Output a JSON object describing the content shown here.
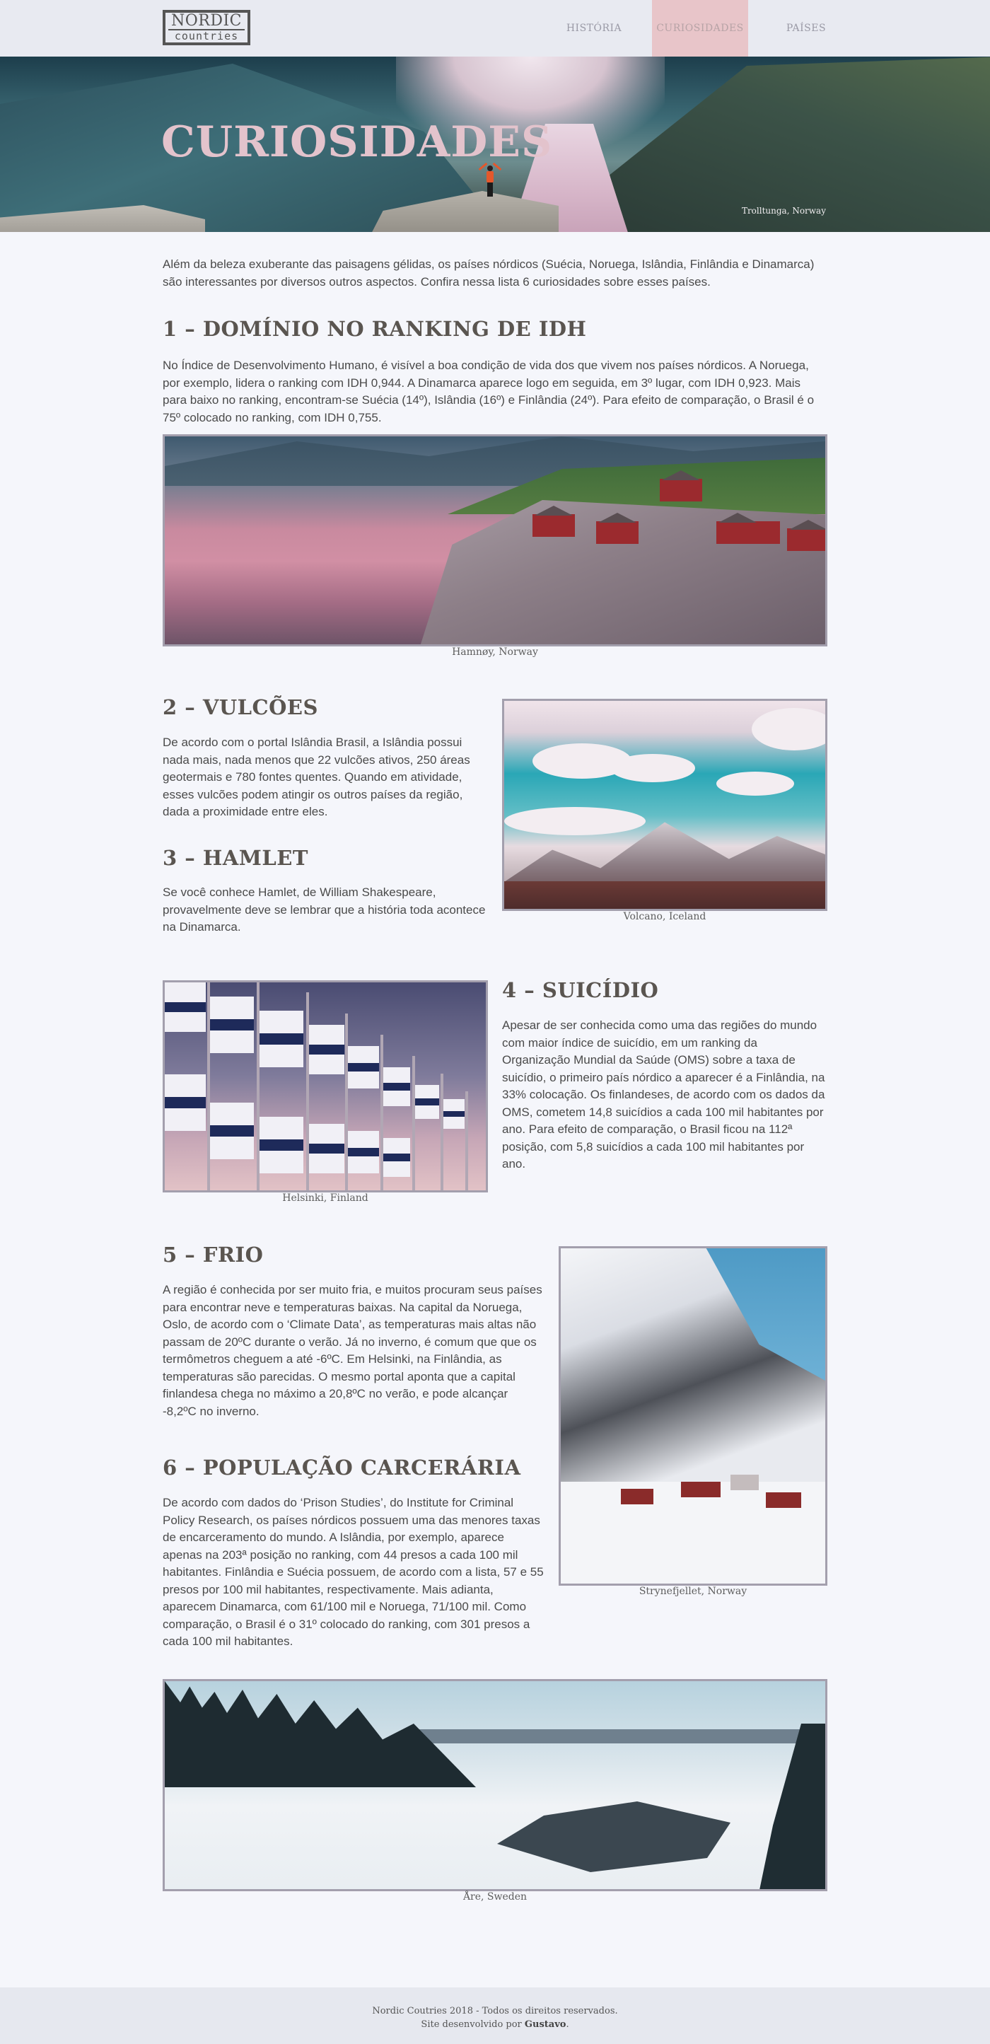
{
  "header": {
    "logo": {
      "line1": "NORDIC",
      "line2": "countries"
    },
    "nav": [
      {
        "label": "HISTÓRIA",
        "active": false
      },
      {
        "label": "CURIOSIDADES",
        "active": true
      },
      {
        "label": "PAÍSES",
        "active": false
      }
    ]
  },
  "hero": {
    "title": "CURIOSIDADES",
    "caption": "Trolltunga, Norway"
  },
  "intro": "Além da beleza exuberante das paisagens gélidas, os países nórdicos (Suécia, Noruega, Islândia, Finlândia e Dinamarca) são interessantes por diversos outros aspectos. Confira nessa lista 6 curiosidades sobre esses países.",
  "sections": [
    {
      "title": "1 – DOMÍNIO NO RANKING DE IDH",
      "text": "No Índice de Desenvolvimento Humano, é visível a boa condição de vida dos que vivem nos países nórdicos. A Noruega, por exemplo, lidera o ranking com IDH 0,944. A Dinamarca aparece logo em seguida, em 3º lugar, com IDH 0,923. Mais para baixo no ranking, encontram-se Suécia (14º), Islândia (16º) e Finlândia (24º). Para efeito de comparação, o Brasil é o 75º colocado no ranking, com IDH 0,755.",
      "caption": "Hamnøy, Norway"
    },
    {
      "title": "2 – VULCÕES",
      "text": "De acordo com o portal Islândia Brasil, a Islândia possui nada mais, nada menos que 22 vulcões ativos, 250 áreas geotermais e 780 fontes quentes. Quando em atividade, esses vulcões podem atingir os outros países da região, dada a proximidade entre eles.",
      "caption": "Volcano, Iceland"
    },
    {
      "title": "3 – HAMLET",
      "text": "Se você conhece Hamlet, de William Shakespeare, provavelmente deve se lembrar que a história toda acontece na Dinamarca."
    },
    {
      "title": "4 – SUICÍDIO",
      "text": "Apesar de ser conhecida como uma das regiões do mundo com maior índice de suicídio, em um ranking da Organização Mundial da Saúde (OMS) sobre a taxa de suicídio, o primeiro país nórdico a aparecer é a Finlândia, na 33% colocação. Os finlandeses, de acordo com os dados da OMS, cometem 14,8 suicídios a cada 100 mil habitantes por ano. Para efeito de comparação, o Brasil ficou na 112ª posição, com 5,8 suicídios a cada 100 mil habitantes por ano.",
      "caption": "Helsinki, Finland"
    },
    {
      "title": "5 – FRIO",
      "text": "A região é conhecida por ser muito fria, e muitos procuram seus países para encontrar neve e temperaturas baixas. Na capital da Noruega, Oslo, de acordo com o ‘Climate Data’, as temperaturas mais altas não passam de 20ºC durante o verão. Já no inverno, é comum que que os termômetros cheguem a até -6ºC. Em Helsinki, na Finlândia, as temperaturas são parecidas. O mesmo portal aponta que a capital finlandesa chega no máximo a 20,8ºC no verão, e pode alcançar -8,2ºC no inverno.",
      "caption": "Strynefjellet, Norway"
    },
    {
      "title": "6 – POPULAÇÃO CARCERÁRIA",
      "text": "De acordo com dados do ‘Prison Studies’, do Institute for Criminal Policy Research, os países nórdicos possuem uma das menores taxas de encarceramento do mundo. A Islândia, por exemplo, aparece apenas na 203ª posição no ranking, com 44 presos a cada 100 mil habitantes. Finlândia e Suécia possuem, de acordo com a lista, 57 e 55 presos por 100 mil habitantes, respectivamente. Mais adianta, aparecem Dinamarca, com 61/100 mil e Noruega, 71/100 mil. Como comparação, o Brasil é o 31º colocado do ranking, com 301 presos a cada 100 mil habitantes.",
      "caption": "Åre, Sweden"
    }
  ],
  "footer": {
    "line1": "Nordic Coutries 2018 - Todos os direitos reservados.",
    "line2_prefix": "Site desenvolvido por ",
    "author": "Gustavo",
    "line2_suffix": "."
  },
  "colors": {
    "accent_nav": "#e8c5c9",
    "title_hero": "#e3c3cc",
    "frame": "#a39fad"
  }
}
